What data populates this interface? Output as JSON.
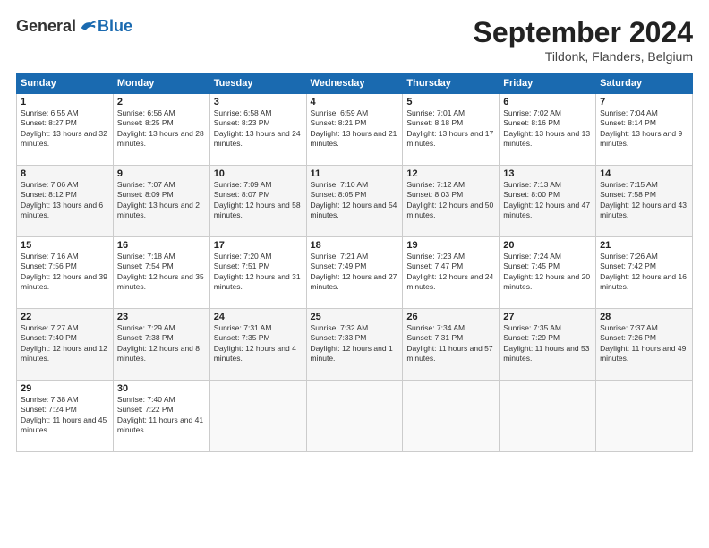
{
  "header": {
    "logo_general": "General",
    "logo_blue": "Blue",
    "month_title": "September 2024",
    "location": "Tildonk, Flanders, Belgium"
  },
  "days_of_week": [
    "Sunday",
    "Monday",
    "Tuesday",
    "Wednesday",
    "Thursday",
    "Friday",
    "Saturday"
  ],
  "weeks": [
    [
      {
        "num": "1",
        "sunrise": "6:55 AM",
        "sunset": "8:27 PM",
        "daylight": "13 hours and 32 minutes."
      },
      {
        "num": "2",
        "sunrise": "6:56 AM",
        "sunset": "8:25 PM",
        "daylight": "13 hours and 28 minutes."
      },
      {
        "num": "3",
        "sunrise": "6:58 AM",
        "sunset": "8:23 PM",
        "daylight": "13 hours and 24 minutes."
      },
      {
        "num": "4",
        "sunrise": "6:59 AM",
        "sunset": "8:21 PM",
        "daylight": "13 hours and 21 minutes."
      },
      {
        "num": "5",
        "sunrise": "7:01 AM",
        "sunset": "8:18 PM",
        "daylight": "13 hours and 17 minutes."
      },
      {
        "num": "6",
        "sunrise": "7:02 AM",
        "sunset": "8:16 PM",
        "daylight": "13 hours and 13 minutes."
      },
      {
        "num": "7",
        "sunrise": "7:04 AM",
        "sunset": "8:14 PM",
        "daylight": "13 hours and 9 minutes."
      }
    ],
    [
      {
        "num": "8",
        "sunrise": "7:06 AM",
        "sunset": "8:12 PM",
        "daylight": "13 hours and 6 minutes."
      },
      {
        "num": "9",
        "sunrise": "7:07 AM",
        "sunset": "8:09 PM",
        "daylight": "13 hours and 2 minutes."
      },
      {
        "num": "10",
        "sunrise": "7:09 AM",
        "sunset": "8:07 PM",
        "daylight": "12 hours and 58 minutes."
      },
      {
        "num": "11",
        "sunrise": "7:10 AM",
        "sunset": "8:05 PM",
        "daylight": "12 hours and 54 minutes."
      },
      {
        "num": "12",
        "sunrise": "7:12 AM",
        "sunset": "8:03 PM",
        "daylight": "12 hours and 50 minutes."
      },
      {
        "num": "13",
        "sunrise": "7:13 AM",
        "sunset": "8:00 PM",
        "daylight": "12 hours and 47 minutes."
      },
      {
        "num": "14",
        "sunrise": "7:15 AM",
        "sunset": "7:58 PM",
        "daylight": "12 hours and 43 minutes."
      }
    ],
    [
      {
        "num": "15",
        "sunrise": "7:16 AM",
        "sunset": "7:56 PM",
        "daylight": "12 hours and 39 minutes."
      },
      {
        "num": "16",
        "sunrise": "7:18 AM",
        "sunset": "7:54 PM",
        "daylight": "12 hours and 35 minutes."
      },
      {
        "num": "17",
        "sunrise": "7:20 AM",
        "sunset": "7:51 PM",
        "daylight": "12 hours and 31 minutes."
      },
      {
        "num": "18",
        "sunrise": "7:21 AM",
        "sunset": "7:49 PM",
        "daylight": "12 hours and 27 minutes."
      },
      {
        "num": "19",
        "sunrise": "7:23 AM",
        "sunset": "7:47 PM",
        "daylight": "12 hours and 24 minutes."
      },
      {
        "num": "20",
        "sunrise": "7:24 AM",
        "sunset": "7:45 PM",
        "daylight": "12 hours and 20 minutes."
      },
      {
        "num": "21",
        "sunrise": "7:26 AM",
        "sunset": "7:42 PM",
        "daylight": "12 hours and 16 minutes."
      }
    ],
    [
      {
        "num": "22",
        "sunrise": "7:27 AM",
        "sunset": "7:40 PM",
        "daylight": "12 hours and 12 minutes."
      },
      {
        "num": "23",
        "sunrise": "7:29 AM",
        "sunset": "7:38 PM",
        "daylight": "12 hours and 8 minutes."
      },
      {
        "num": "24",
        "sunrise": "7:31 AM",
        "sunset": "7:35 PM",
        "daylight": "12 hours and 4 minutes."
      },
      {
        "num": "25",
        "sunrise": "7:32 AM",
        "sunset": "7:33 PM",
        "daylight": "12 hours and 1 minute."
      },
      {
        "num": "26",
        "sunrise": "7:34 AM",
        "sunset": "7:31 PM",
        "daylight": "11 hours and 57 minutes."
      },
      {
        "num": "27",
        "sunrise": "7:35 AM",
        "sunset": "7:29 PM",
        "daylight": "11 hours and 53 minutes."
      },
      {
        "num": "28",
        "sunrise": "7:37 AM",
        "sunset": "7:26 PM",
        "daylight": "11 hours and 49 minutes."
      }
    ],
    [
      {
        "num": "29",
        "sunrise": "7:38 AM",
        "sunset": "7:24 PM",
        "daylight": "11 hours and 45 minutes."
      },
      {
        "num": "30",
        "sunrise": "7:40 AM",
        "sunset": "7:22 PM",
        "daylight": "11 hours and 41 minutes."
      },
      null,
      null,
      null,
      null,
      null
    ]
  ]
}
